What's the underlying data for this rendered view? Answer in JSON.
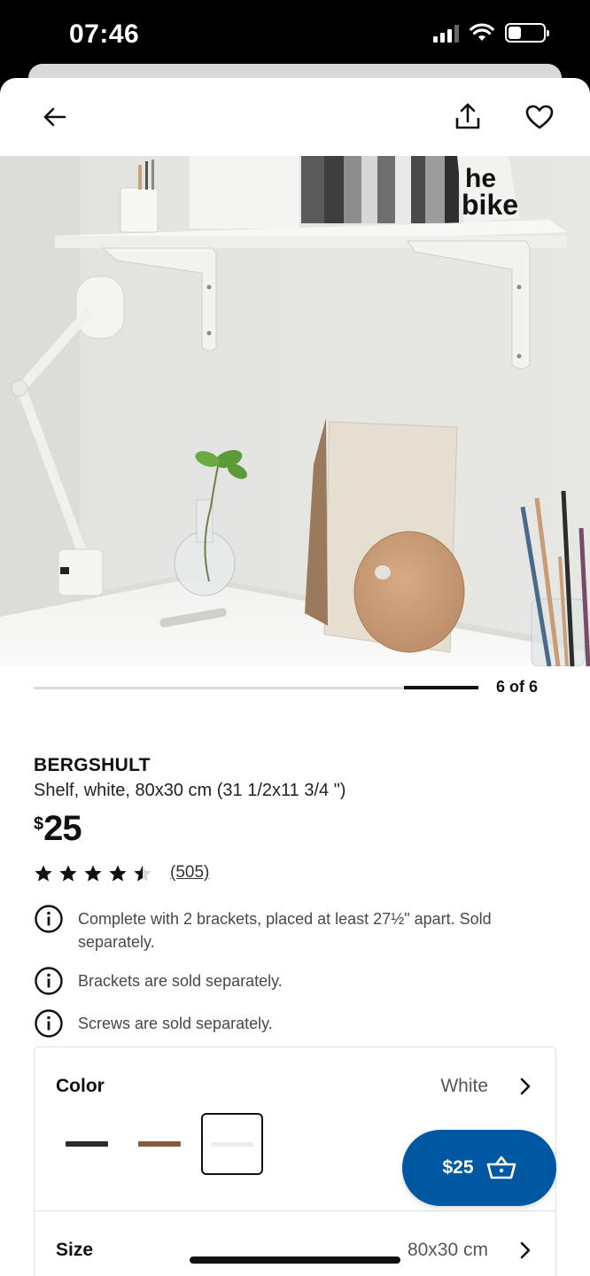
{
  "status_bar": {
    "time": "07:46"
  },
  "header": {
    "back_icon": "arrow-left-icon",
    "share_icon": "share-upload-icon",
    "favorite_icon": "heart-outline-icon"
  },
  "gallery": {
    "counter": "6 of 6",
    "current": 6,
    "total": 6
  },
  "product": {
    "name": "BERGSHULT",
    "description": "Shelf, white, 80x30 cm (31 1/2x11 3/4 \")",
    "price_currency": "$",
    "price_amount": "25",
    "rating": 4.5,
    "rating_max": 5,
    "review_count": "(505)"
  },
  "notes": [
    "Complete with 2 brackets, placed at least 27½\" apart. Sold separately.",
    "Brackets are sold separately.",
    "Screws are sold separately."
  ],
  "options": {
    "color_label": "Color",
    "color_value": "White",
    "swatches": [
      {
        "name": "black-brown",
        "color": "#2b2b2b",
        "selected": false
      },
      {
        "name": "brown",
        "color": "#8a5a3c",
        "selected": false
      },
      {
        "name": "white",
        "color": "#ececec",
        "selected": true
      }
    ],
    "size_label": "Size",
    "size_value": "80x30 cm"
  },
  "cart_button": {
    "label": "$25",
    "icon": "shopping-basket-icon"
  },
  "colors": {
    "accent_blue": "#0058a3",
    "star": "#111111"
  }
}
